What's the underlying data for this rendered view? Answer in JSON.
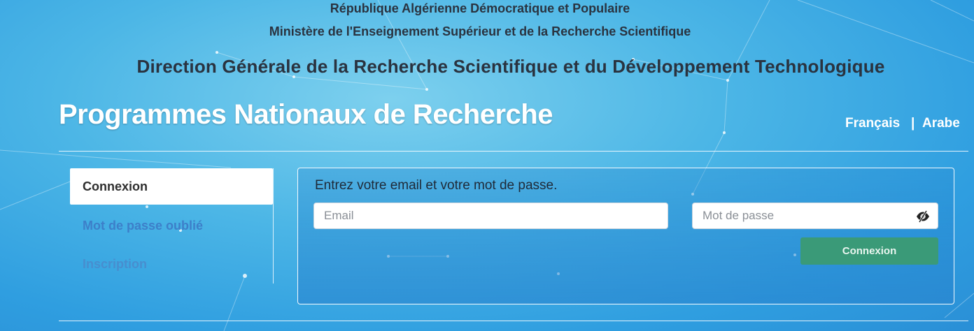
{
  "header": {
    "republic": "République Algérienne Démocratique et Populaire",
    "ministry": "Ministère de l'Enseignement Supérieur et de la Recherche Scientifique",
    "direction": "Direction Générale de la Recherche Scientifique et du Développement Technologique"
  },
  "title": "Programmes Nationaux de Recherche",
  "languages": {
    "french": "Français",
    "separator": "|",
    "arabic": "Arabe"
  },
  "sidebar": {
    "items": [
      {
        "label": "Connexion",
        "active": true
      },
      {
        "label": "Mot de passe oublié",
        "active": false
      },
      {
        "label": "Inscription",
        "active": false
      }
    ]
  },
  "login": {
    "instruction": "Entrez votre email et votre mot de passe.",
    "email_placeholder": "Email",
    "email_value": "",
    "password_placeholder": "Mot de passe",
    "password_value": "",
    "password_toggle_icon": "eye-slash-icon",
    "submit_label": "Connexion"
  },
  "colors": {
    "background": "#4cb6e6",
    "submit_button": "#3a9a78",
    "sidebar_link": "#3d7fc9"
  }
}
